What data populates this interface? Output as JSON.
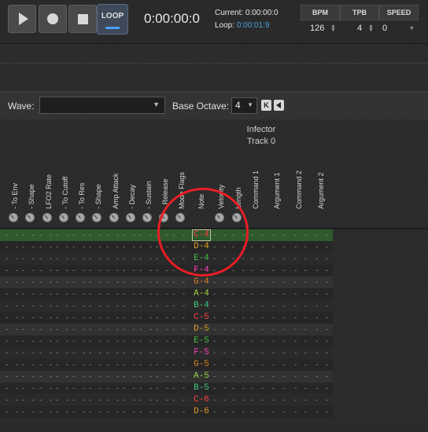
{
  "transport": {
    "loop_label": "LOOP",
    "time": "0:00:00:0",
    "current_label": "Current: 0:00:00:0",
    "loop_prefix": "Loop: ",
    "loop_value": "0:00:01:9"
  },
  "tempo": {
    "bpm_label": "BPM",
    "bpm": "126",
    "tpb_label": "TPB",
    "tpb": "4",
    "speed_label": "SPEED",
    "speed": "0"
  },
  "wave": {
    "label": "Wave:",
    "value": ""
  },
  "octave": {
    "label": "Base Octave:",
    "value": "4",
    "k": "K"
  },
  "instrument": {
    "name": "Infector",
    "track": "Track 0"
  },
  "columns": [
    "- To Env",
    "- Shape",
    "LFO2 Rate",
    "- To Cutoff",
    "- To Res",
    "- Shape",
    "Amp Attack",
    "- Decay",
    "- Sustain",
    "- Release",
    "Mode Flags",
    "Note",
    "Velocity",
    "Length",
    "Command 1",
    "Argument 1",
    "Command 2",
    "Argument 2"
  ],
  "notes": [
    "C-4",
    "D-4",
    "E-4",
    "F-4",
    "G-4",
    "A-4",
    "B-4",
    "C-5",
    "D-5",
    "E-5",
    "F-5",
    "G-5",
    "A-5",
    "B-5",
    "C-6",
    "D-6"
  ],
  "note_colors": {
    "C": "#ff4040",
    "D": "#e0a020",
    "E": "#40c040",
    "F": "#ff40c0",
    "G": "#e08020",
    "A": "#a0d040",
    "B": "#40d080"
  },
  "empty_cell": "- -",
  "colors": {
    "accent": "#4aa0ff",
    "annotation": "#e81e25",
    "highlight_row": "#2e5a2e"
  }
}
